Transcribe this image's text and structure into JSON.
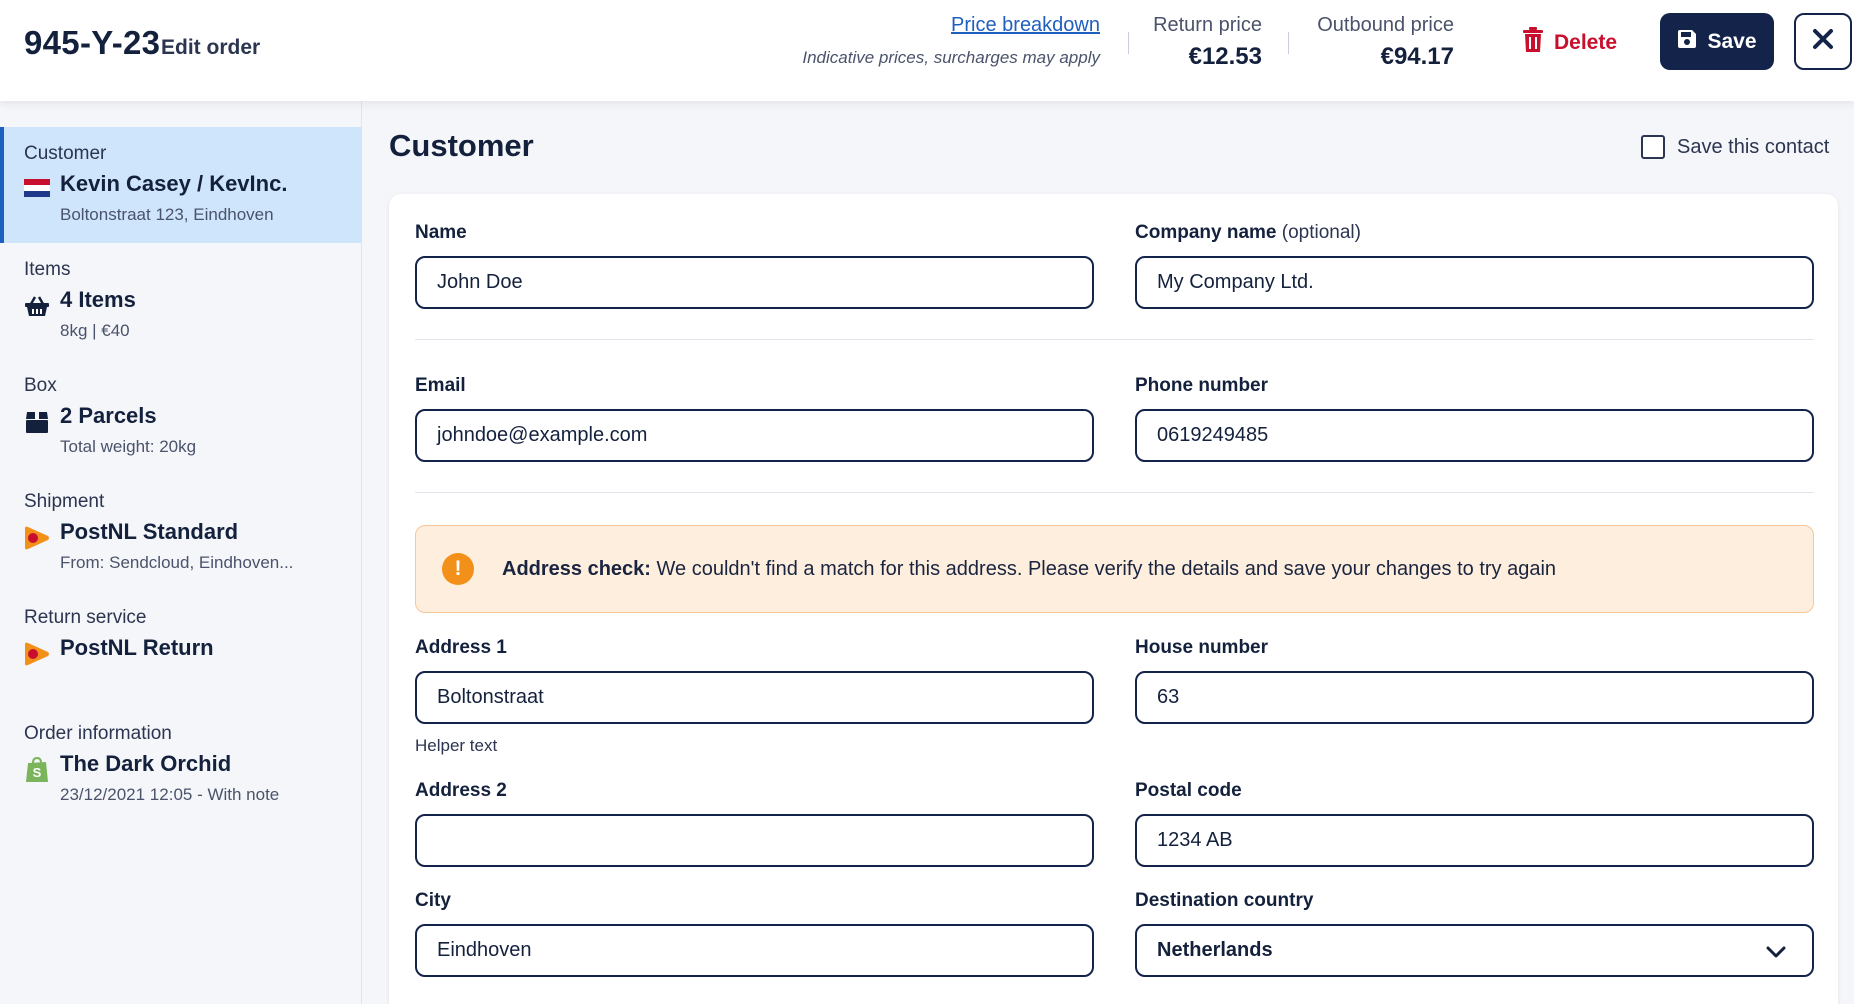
{
  "header": {
    "order_id": "945-Y-23",
    "edit_label": "Edit order",
    "price_breakdown_link": "Price breakdown",
    "price_note": "Indicative prices, surcharges may apply",
    "return_price_label": "Return price",
    "return_price_value": "€12.53",
    "outbound_price_label": "Outbound price",
    "outbound_price_value": "€94.17",
    "delete_label": "Delete",
    "save_label": "Save",
    "icons": {
      "delete": "trash-icon",
      "save": "floppy-disk-icon",
      "close": "close-icon"
    },
    "colors": {
      "delete": "#c8102e",
      "save_bg": "#13234a",
      "link": "#1f5fbf"
    }
  },
  "sidebar": {
    "items": [
      {
        "label": "Customer",
        "title": "Kevin Casey / KevInc.",
        "sub": "Boltonstraat 123, Eindhoven",
        "icon": "netherlands-flag-icon",
        "active": true
      },
      {
        "label": "Items",
        "title": "4 Items",
        "sub": "8kg | €40",
        "icon": "basket-icon",
        "active": false
      },
      {
        "label": "Box",
        "title": "2 Parcels",
        "sub": "Total weight: 20kg",
        "icon": "box-icon",
        "active": false
      },
      {
        "label": "Shipment",
        "title": "PostNL Standard",
        "sub": "From: Sendcloud, Eindhoven...",
        "icon": "postnl-logo-icon",
        "active": false
      },
      {
        "label": "Return service",
        "title": "PostNL Return",
        "sub": "",
        "icon": "postnl-logo-icon",
        "active": false
      },
      {
        "label": "Order information",
        "title": "The Dark Orchid",
        "sub": "23/12/2021 12:05 - With note",
        "icon": "shopify-bag-icon",
        "active": false
      }
    ]
  },
  "main": {
    "title": "Customer",
    "save_contact_label": "Save this contact",
    "save_contact_checked": false
  },
  "form": {
    "name_label": "Name",
    "name_value": "John Doe",
    "company_label": "Company name",
    "company_optional": "(optional)",
    "company_value": "My Company Ltd.",
    "email_label": "Email",
    "email_value": "johndoe@example.com",
    "phone_label": "Phone number",
    "phone_value": "0619249485",
    "alert_title": "Address check:",
    "alert_text": "We couldn't find a match for this address. Please verify the details and save your changes to try again",
    "alert_icon": "warning-icon",
    "address1_label": "Address 1",
    "address1_value": "Boltonstraat",
    "address1_helper": "Helper text",
    "house_number_label": "House number",
    "house_number_value": "63",
    "address2_label": "Address 2",
    "address2_value": "",
    "postal_code_label": "Postal code",
    "postal_code_value": "1234 AB",
    "city_label": "City",
    "city_value": "Eindhoven",
    "country_label": "Destination country",
    "country_value": "Netherlands"
  }
}
